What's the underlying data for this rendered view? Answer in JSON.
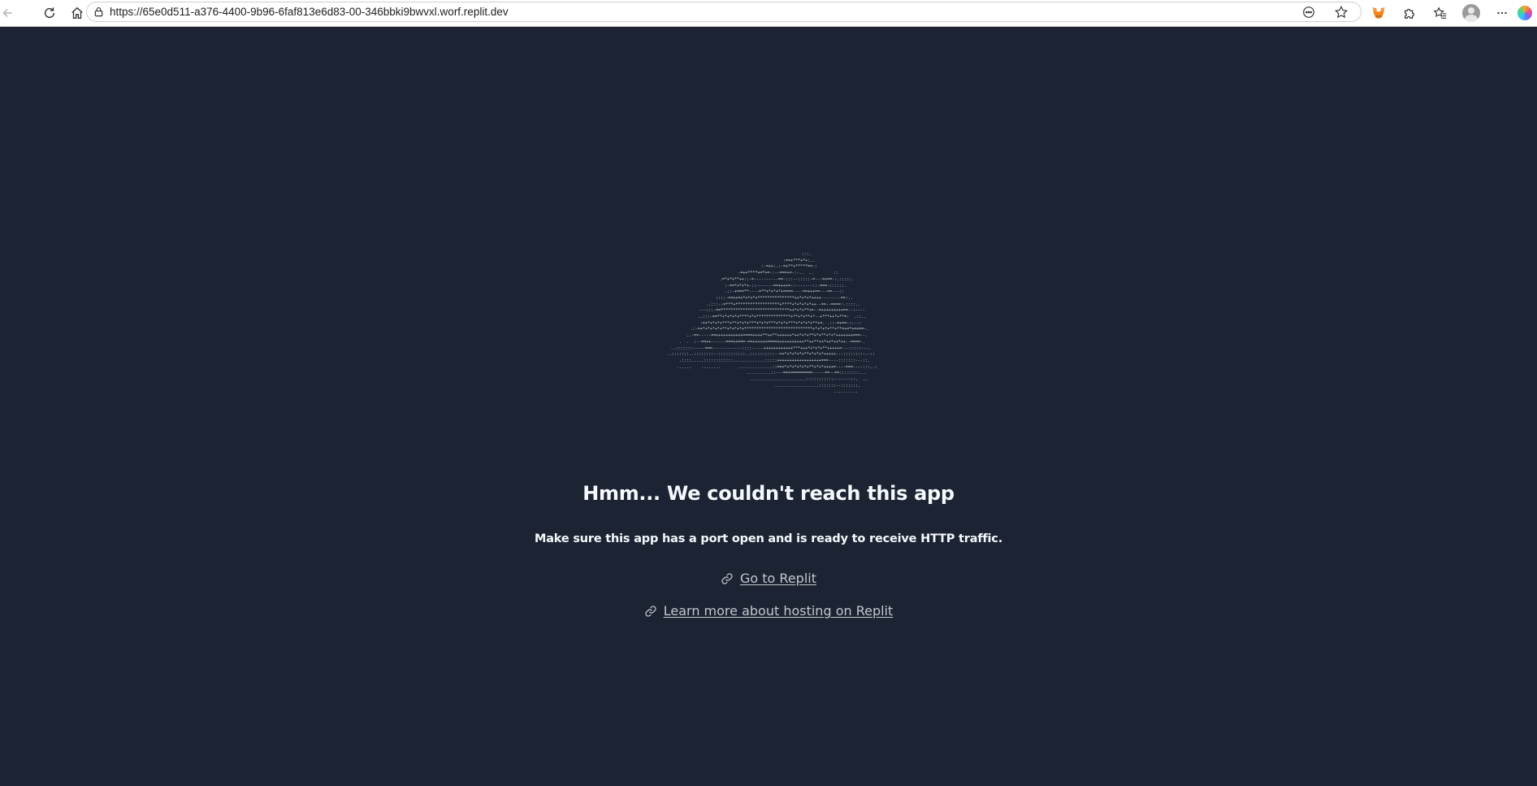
{
  "browser": {
    "url": "https://65e0d511-a376-4400-9b96-6faf813e6d83-00-346bbki9bwvxl.worf.replit.dev"
  },
  "page": {
    "ascii_art": "                               :::.\n                         :==+***+*+:..\n                 :-=++:.:-=+**+*****==-:\n                -=++****+=*+=-:--===+=-:-..  ..        ::\n               .=*+*+**++::-=----------==-:::--:::::-=---=+==-:.:::::.\n              :-==*+*+*+-::-------==++++=-:-------::-===-::::::.\n             .::-+===**----=**+*+*+*+====----==+++==---==---::\n             ::::-==++=+*+*+*+***************++*+*+*++++--------==:..\n            ..:::--=***+******************+****+*+*+*+*++--==--====:-::::..\n           ---:::-==****************************++*+*+**+=--=+++++++++==--:----\n           ..:::-==**+*+*+*+****+*+**************+**+*+**+*--+***++*+**=:  .::..\n          :=+*+*+*+***+**+*+*+***+*+*+***+*+*+***+*+*+*+**+=. .::-=+==-::--:\n         .:-=+*+*+*+*+**+*+*+*+****************************+*+*+*+**+**=+=*+=+==-.\n       ..-==-----==+++++++++++====++++**++**++++++*++*+*+**+*+**+*+*+++++++===--.\n   .  .  :--==++------===++===-==++++++====+++++++++++**++**++*++*++*++--====-.\n  ..:::::::-----===------------::::-----++++++++++++***+++*+*+*+**+++++=---:::::---.\n  ..:::::::..::::::::--:::::::::::..::::::::::--=+*+*+*+*+**+*+*+*+++++---::::::::---::\n     .::::.....::::::::::::.............:::::++++++++++++++++++===----:::::::---::.\n       ......    ........       ..............::==+*+*+*+*+*+**+*+*++++=----===----:::..:\n                               ..........::---==+=========-----==--==::::::::...\n                                 .......................:::::::::::-------::.  ..\n                                        ..................:::::::--:::::::.\n                                                               ..........",
    "title": "Hmm... We couldn't reach this app",
    "subtitle": "Make sure this app has a port open and is ready to receive HTTP traffic.",
    "links": [
      {
        "label": "Go to Replit",
        "icon": "link-icon"
      },
      {
        "label": "Learn more about hosting on Replit",
        "icon": "link-icon"
      }
    ]
  },
  "colors": {
    "background": "#1c2333",
    "text": "#f5f9fc",
    "link": "#c2c8cc"
  }
}
